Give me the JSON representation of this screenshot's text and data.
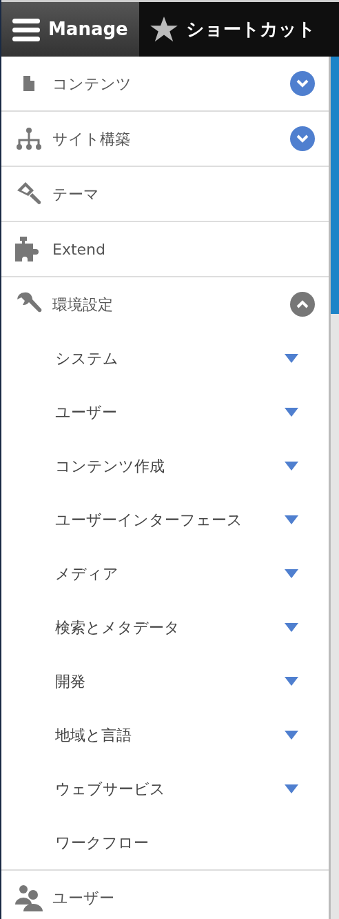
{
  "toolbar": {
    "tabs": [
      {
        "label": "Manage",
        "selected": true
      },
      {
        "label": "ショートカット",
        "selected": false
      }
    ]
  },
  "menu": [
    {
      "label": "コンテンツ",
      "expanded": false
    },
    {
      "label": "サイト構築",
      "expanded": false
    },
    {
      "label": "テーマ"
    },
    {
      "label": "Extend"
    },
    {
      "label": "環境設定",
      "expanded": true,
      "children": [
        {
          "label": "システム",
          "expandable": true
        },
        {
          "label": "ユーザー",
          "expandable": true
        },
        {
          "label": "コンテンツ作成",
          "expandable": true
        },
        {
          "label": "ユーザーインターフェース",
          "expandable": true
        },
        {
          "label": "メディア",
          "expandable": true
        },
        {
          "label": "検索とメタデータ",
          "expandable": true
        },
        {
          "label": "開発",
          "expandable": true
        },
        {
          "label": "地域と言語",
          "expandable": true
        },
        {
          "label": "ウェブサービス",
          "expandable": true
        },
        {
          "label": "ワークフロー",
          "expandable": false
        }
      ]
    },
    {
      "label": "ユーザー"
    }
  ]
}
